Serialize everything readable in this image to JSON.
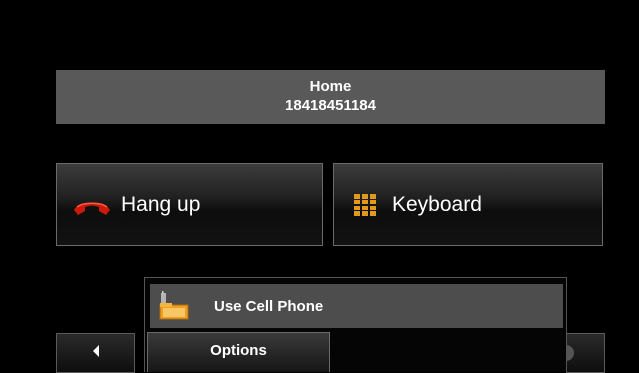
{
  "caller": {
    "name": "Home",
    "number": "18418451184"
  },
  "buttons": {
    "hangup_label": "Hang up",
    "keyboard_label": "Keyboard"
  },
  "popup": {
    "item_label": "Use Cell Phone",
    "options_label": "Options"
  },
  "icons": {
    "hangup": "phone-hangup-icon",
    "keyboard": "keypad-icon",
    "cell_phone": "cell-phone-icon",
    "nav_left": "arrow-left-icon"
  },
  "colors": {
    "background": "#000000",
    "caller_bar": "#595959",
    "hangup_red": "#cc1a0a",
    "keypad_orange": "#e39a1c",
    "menu_item_bg": "#4d4d4d"
  }
}
